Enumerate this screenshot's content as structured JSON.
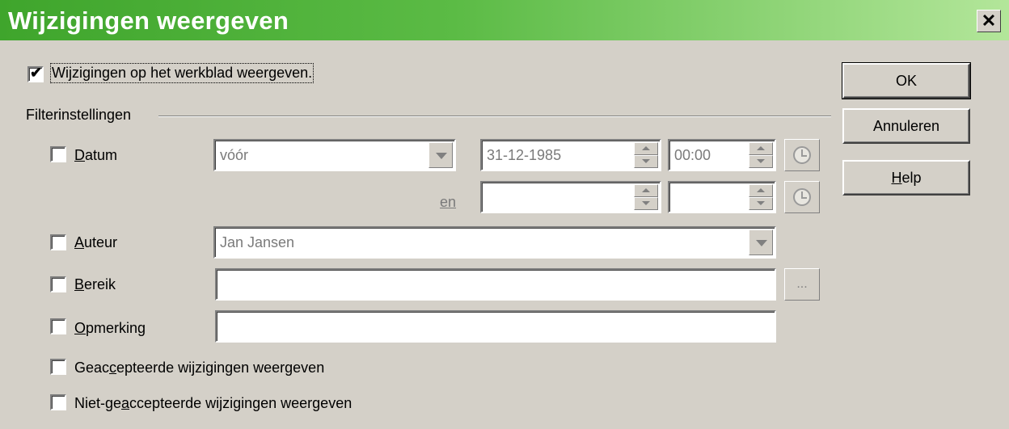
{
  "window": {
    "title": "Wijzigingen weergeven",
    "close_glyph": "✕"
  },
  "show_changes": {
    "label": "Wijzigingen op het werkblad weergeven.",
    "checked": true,
    "check_glyph": "✔"
  },
  "filter_section": {
    "title": "Filterinstellingen"
  },
  "date_filter": {
    "label_accel": "D",
    "label_rest": "atum",
    "condition": "vóór",
    "date_from": "31-12-1985",
    "time_from": "00:00",
    "and_label": "en",
    "date_to": "",
    "time_to": ""
  },
  "author_filter": {
    "label_accel": "A",
    "label_rest": "uteur",
    "value": "Jan Jansen"
  },
  "range_filter": {
    "label_accel": "B",
    "label_rest": "ereik",
    "value": "",
    "browse_label": "..."
  },
  "comment_filter": {
    "label_accel": "O",
    "label_rest": "pmerking",
    "value": ""
  },
  "accepted": {
    "pre": "Geac",
    "accel": "c",
    "post": "epteerde wijzigingen weergeven"
  },
  "rejected": {
    "pre": "Niet-ge",
    "accel": "a",
    "post": "ccepteerde wijzigingen weergeven"
  },
  "buttons": {
    "ok": "OK",
    "cancel": "Annuleren",
    "help_accel": "H",
    "help_rest": "elp"
  },
  "colors": {
    "titlebar_start": "#3fa52c",
    "titlebar_end": "#b3e69a",
    "dialog_bg": "#d4d0c8"
  }
}
